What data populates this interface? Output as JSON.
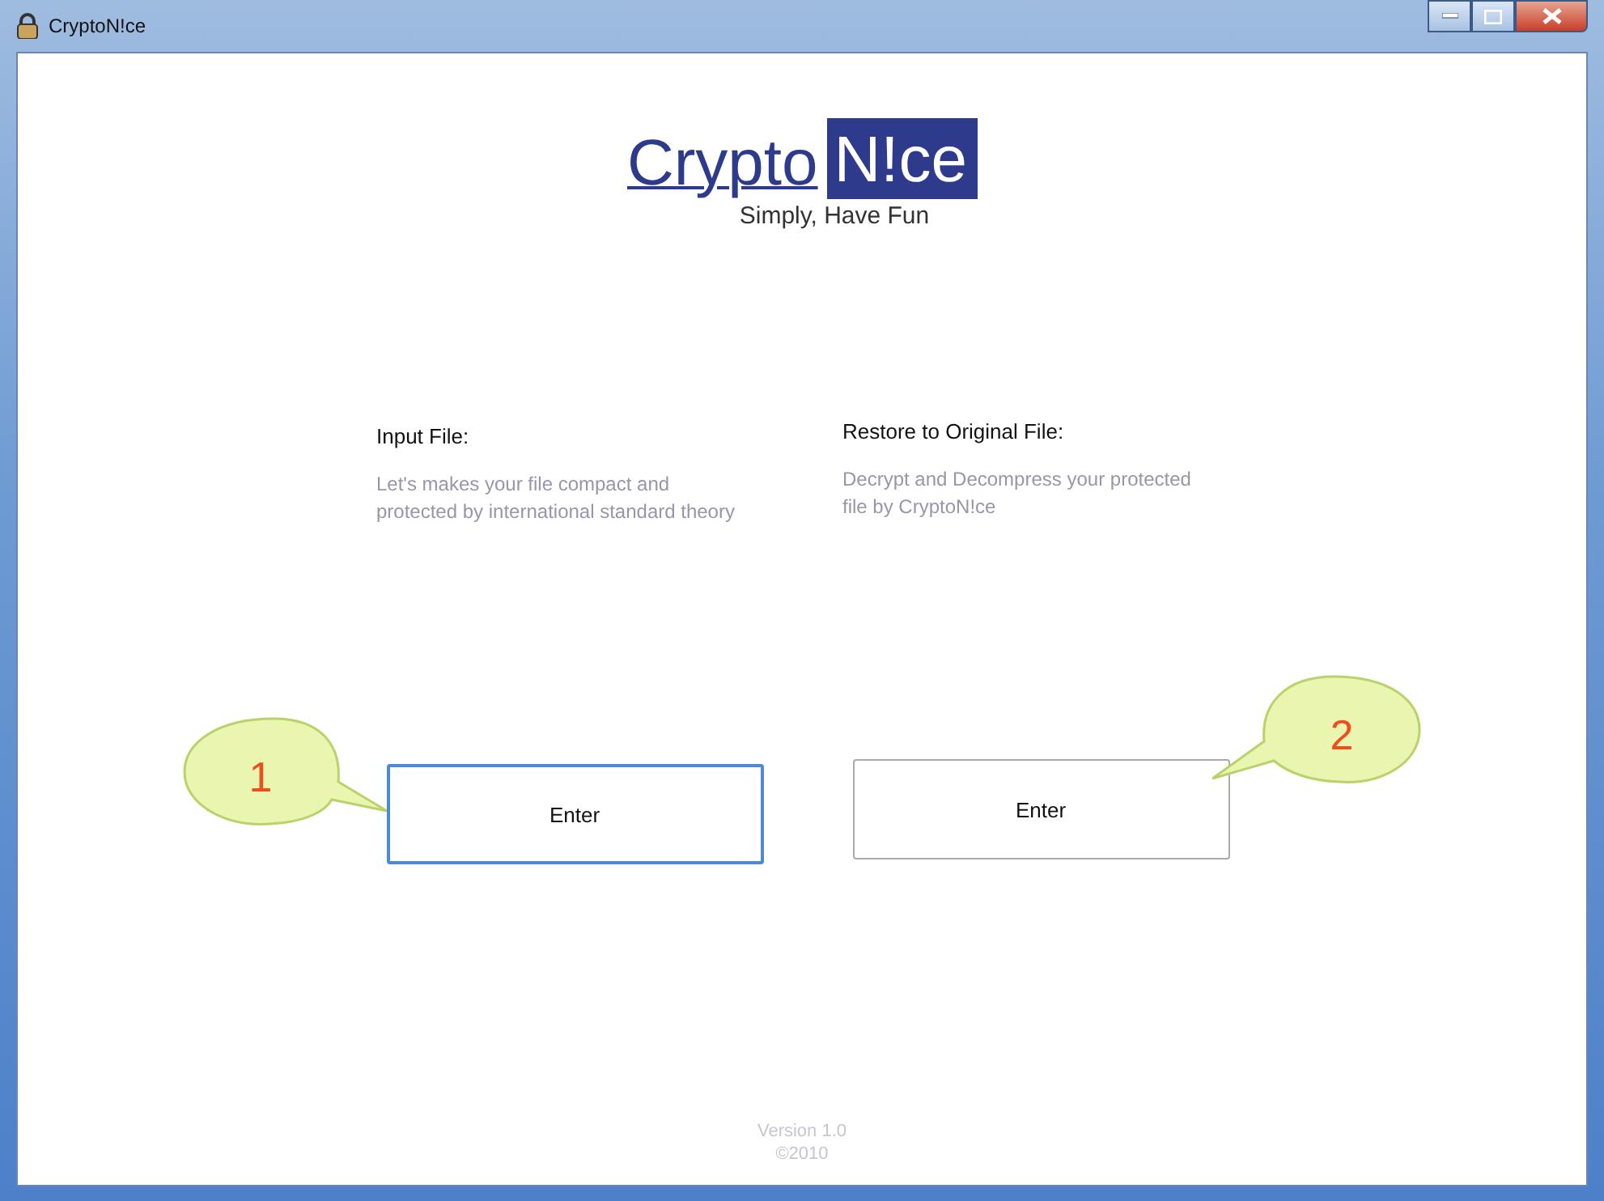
{
  "window": {
    "title": "CryptoN!ce"
  },
  "logo": {
    "part_1": "Crypto",
    "part_2": "N!ce",
    "tagline": "Simply, Have Fun"
  },
  "sections": [
    {
      "heading": "Input File:",
      "description": "Let's makes your file compact and protected by international standard theory",
      "button": "Enter",
      "focused": true,
      "callout": "1"
    },
    {
      "heading": "Restore to Original File:",
      "description": "Decrypt and Decompress your protected file by CryptoN!ce",
      "button": "Enter",
      "focused": false,
      "callout": "2"
    }
  ],
  "footer": {
    "version": "Version 1.0",
    "copyright": "©2010"
  }
}
